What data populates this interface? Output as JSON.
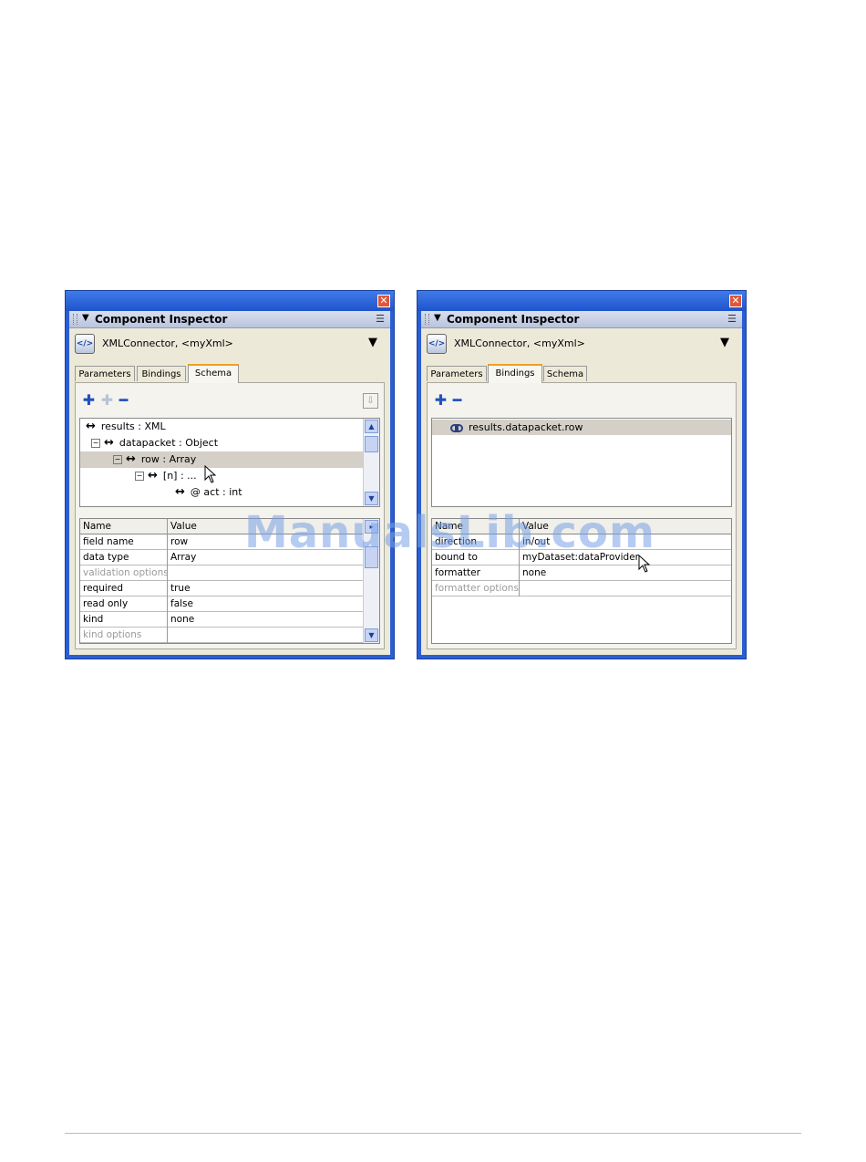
{
  "left_window": {
    "panel_title": "Component Inspector",
    "component_name": "XMLConnector, <myXml>",
    "tabs": [
      "Parameters",
      "Bindings",
      "Schema"
    ],
    "active_tab": "Schema",
    "tree": [
      {
        "label": "results : XML"
      },
      {
        "label": "datapacket : Object"
      },
      {
        "label": "row : Array"
      },
      {
        "label": "[n] : ..."
      },
      {
        "label": "@ act : int"
      }
    ],
    "grid_headers": {
      "name": "Name",
      "value": "Value"
    },
    "grid_rows": [
      {
        "name": "field name",
        "value": "row"
      },
      {
        "name": "data type",
        "value": "Array"
      },
      {
        "name": "validation options",
        "value": ""
      },
      {
        "name": "required",
        "value": "true"
      },
      {
        "name": "read only",
        "value": "false"
      },
      {
        "name": "kind",
        "value": "none"
      },
      {
        "name": "kind options",
        "value": ""
      }
    ]
  },
  "right_window": {
    "panel_title": "Component Inspector",
    "component_name": "XMLConnector, <myXml>",
    "tabs": [
      "Parameters",
      "Bindings",
      "Schema"
    ],
    "active_tab": "Bindings",
    "bindings": [
      "results.datapacket.row"
    ],
    "grid_headers": {
      "name": "Name",
      "value": "Value"
    },
    "grid_rows": [
      {
        "name": "direction",
        "value": "in/out"
      },
      {
        "name": "bound to",
        "value": "myDataset:dataProvider"
      },
      {
        "name": "formatter",
        "value": "none"
      },
      {
        "name": "formatter options",
        "value": ""
      }
    ]
  },
  "watermark": "ManualsLib.com",
  "colors": {
    "titlebar": "#2a5ed3",
    "panel_bg": "#ece9d8",
    "active_tab_accent": "#f0a020",
    "selection": "#d4d0c8"
  }
}
